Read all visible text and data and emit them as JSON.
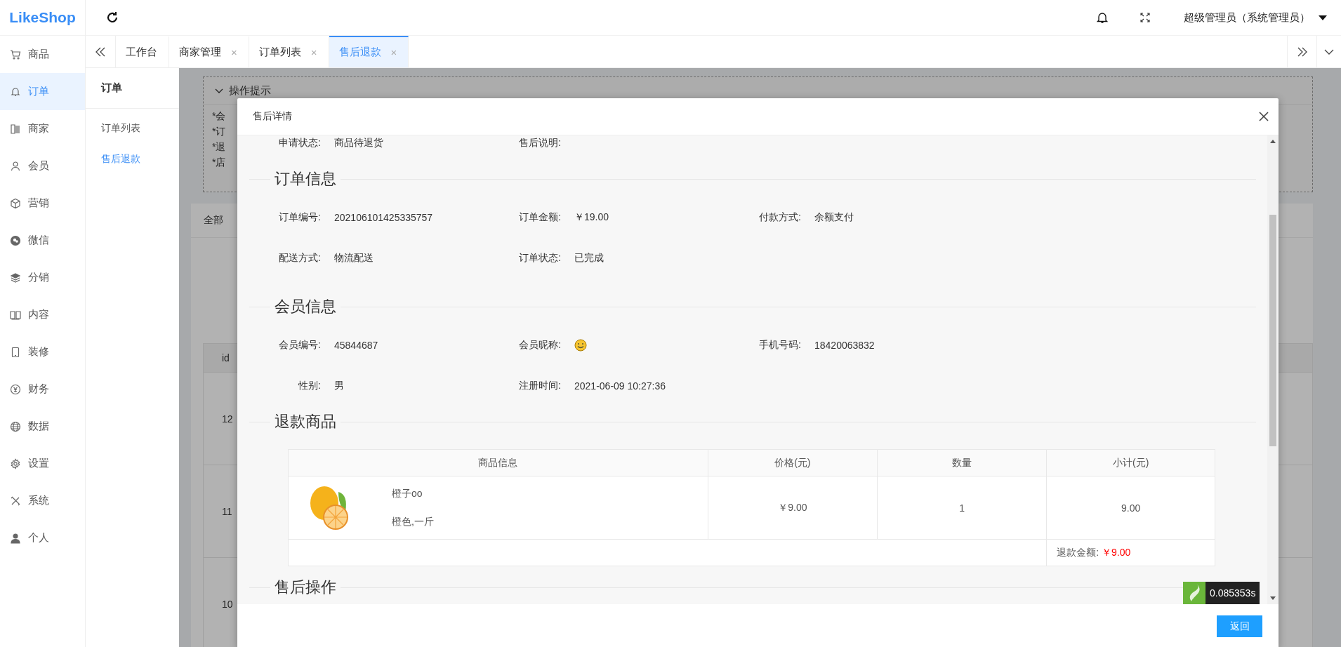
{
  "logo": "LikeShop",
  "header": {
    "user": "超级管理员（系统管理员）"
  },
  "sidebar": {
    "items": [
      {
        "label": "商品",
        "selected": false
      },
      {
        "label": "订单",
        "selected": true
      },
      {
        "label": "商家",
        "selected": false
      },
      {
        "label": "会员",
        "selected": false
      },
      {
        "label": "营销",
        "selected": false
      },
      {
        "label": "微信",
        "selected": false
      },
      {
        "label": "分销",
        "selected": false
      },
      {
        "label": "内容",
        "selected": false
      },
      {
        "label": "装修",
        "selected": false
      },
      {
        "label": "财务",
        "selected": false
      },
      {
        "label": "数据",
        "selected": false
      },
      {
        "label": "设置",
        "selected": false
      },
      {
        "label": "系统",
        "selected": false
      },
      {
        "label": "个人",
        "selected": false
      }
    ]
  },
  "tabs": [
    {
      "label": "工作台",
      "selected": false
    },
    {
      "label": "商家管理",
      "close": "×",
      "selected": false
    },
    {
      "label": "订单列表",
      "close": "×",
      "selected": false
    },
    {
      "label": "售后退款",
      "close": "×",
      "selected": true
    }
  ],
  "subnav": {
    "title": "订单",
    "items": [
      {
        "label": "订单列表",
        "selected": false
      },
      {
        "label": "售后退款",
        "selected": true
      }
    ]
  },
  "background_page": {
    "tips_title": "操作提示",
    "tips": [
      "*会",
      "*订",
      "*退",
      "*店"
    ],
    "tab": "全部",
    "id_column": "id",
    "ids": [
      "12",
      "11",
      "10"
    ]
  },
  "dialog": {
    "title": "售后详情",
    "top_fields": [
      {
        "label": "申请状态:",
        "kind": "text",
        "value": "商品待退货"
      },
      {
        "label": "售后说明:",
        "kind": "text"
      }
    ],
    "sections": [
      {
        "title": "订单信息",
        "rows": [
          [
            {
              "label": "订单编号:",
              "kind": "text",
              "value": "202106101425335757"
            },
            {
              "label": "订单金额:",
              "kind": "text",
              "value": "￥19.00"
            },
            {
              "label": "付款方式:",
              "kind": "text",
              "value": "余额支付"
            }
          ],
          [
            {
              "label": "配送方式:",
              "kind": "text",
              "value": "物流配送"
            },
            {
              "label": "订单状态:",
              "kind": "text",
              "value": "已完成"
            }
          ]
        ]
      },
      {
        "title": "会员信息",
        "rows": [
          [
            {
              "label": "会员编号:",
              "kind": "text",
              "value": "45844687"
            },
            {
              "label": "会员昵称:",
              "kind": "emoji"
            },
            {
              "label": "手机号码:",
              "kind": "text",
              "value": "18420063832"
            }
          ],
          [
            {
              "label": "性别:",
              "kind": "text",
              "value": "男"
            },
            {
              "label": "注册时间:",
              "kind": "text",
              "value": "2021-06-09 10:27:36"
            }
          ]
        ]
      }
    ],
    "goods_title": "退款商品",
    "goods_table": {
      "columns": [
        "商品信息",
        "价格(元)",
        "数量",
        "小计(元)"
      ],
      "rows": [
        {
          "name": "橙子oo",
          "spec": "橙色,一斤",
          "price": "￥9.00",
          "quantity": "1",
          "subtotal": "9.00"
        }
      ],
      "refund_label": "退款金额:",
      "refund_amount": "￥9.00"
    },
    "action_title": "售后操作",
    "back_button": "返回"
  },
  "debug_badge": "0.085353s"
}
